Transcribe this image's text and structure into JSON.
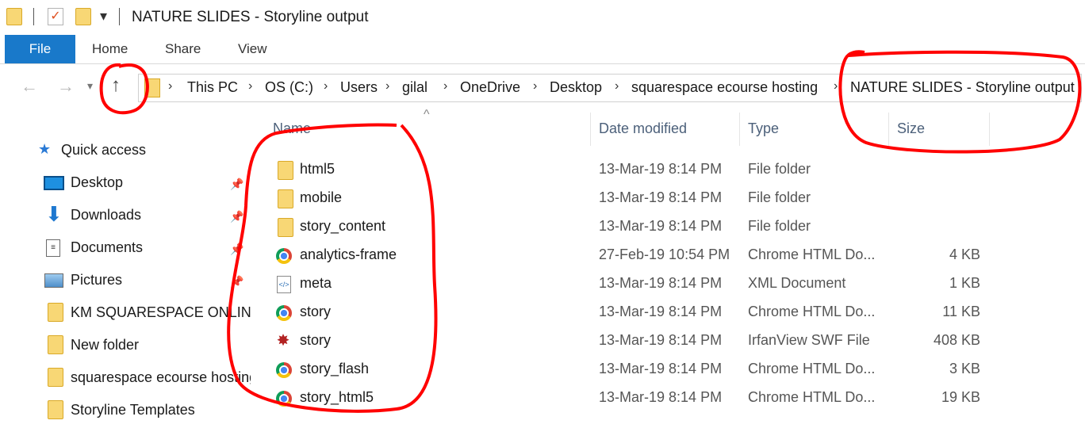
{
  "window": {
    "title": "NATURE SLIDES - Storyline output"
  },
  "ribbon": {
    "tabs": [
      "File",
      "Home",
      "Share",
      "View"
    ]
  },
  "address": {
    "crumbs": [
      "This PC",
      "OS (C:)",
      "Users",
      "gilal",
      "OneDrive",
      "Desktop",
      "squarespace ecourse hosting",
      "NATURE SLIDES - Storyline output"
    ]
  },
  "columns": {
    "name": "Name",
    "date": "Date modified",
    "type": "Type",
    "size": "Size"
  },
  "sidebar": {
    "quick_access": "Quick access",
    "items": [
      "Desktop",
      "Downloads",
      "Documents",
      "Pictures",
      "KM SQUARESPACE ONLINE",
      "New folder",
      "squarespace ecourse hosting",
      "Storyline Templates"
    ]
  },
  "files": [
    {
      "name": "html5",
      "date": "13-Mar-19 8:14 PM",
      "type": "File folder",
      "size": "",
      "icon": "folder-icon"
    },
    {
      "name": "mobile",
      "date": "13-Mar-19 8:14 PM",
      "type": "File folder",
      "size": "",
      "icon": "folder-icon"
    },
    {
      "name": "story_content",
      "date": "13-Mar-19 8:14 PM",
      "type": "File folder",
      "size": "",
      "icon": "folder-icon"
    },
    {
      "name": "analytics-frame",
      "date": "27-Feb-19 10:54 PM",
      "type": "Chrome HTML Do...",
      "size": "4 KB",
      "icon": "chrome-icon"
    },
    {
      "name": "meta",
      "date": "13-Mar-19 8:14 PM",
      "type": "XML Document",
      "size": "1 KB",
      "icon": "xml-file-icon"
    },
    {
      "name": "story",
      "date": "13-Mar-19 8:14 PM",
      "type": "Chrome HTML Do...",
      "size": "11 KB",
      "icon": "chrome-icon"
    },
    {
      "name": "story",
      "date": "13-Mar-19 8:14 PM",
      "type": "IrfanView SWF File",
      "size": "408 KB",
      "icon": "swf-file-icon"
    },
    {
      "name": "story_flash",
      "date": "13-Mar-19 8:14 PM",
      "type": "Chrome HTML Do...",
      "size": "3 KB",
      "icon": "chrome-icon"
    },
    {
      "name": "story_html5",
      "date": "13-Mar-19 8:14 PM",
      "type": "Chrome HTML Do...",
      "size": "19 KB",
      "icon": "chrome-icon"
    }
  ],
  "colors": {
    "file_tab": "#1979ca",
    "folder": "#f8d775",
    "annotation": "#ff0000",
    "header_text": "#4c607a"
  }
}
